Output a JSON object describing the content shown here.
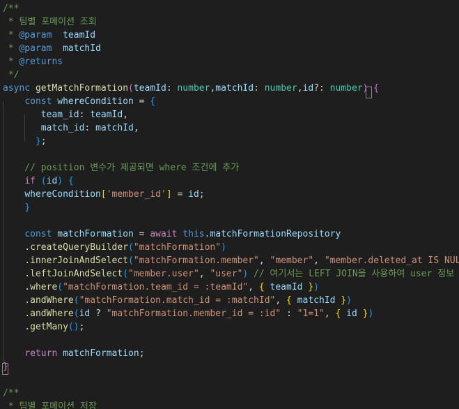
{
  "colors": {
    "background": "#1e1e1e",
    "comment": "#6a9955",
    "keyword": "#569cd6",
    "control": "#c586c0",
    "function": "#dcdcaa",
    "variable": "#9cdcfe",
    "type": "#4ec9b0",
    "string": "#ce9178",
    "text": "#d4d4d4",
    "bracket1": "#ffd700",
    "bracket2": "#da70d6",
    "bracket3": "#179fff",
    "docTag": "#569cd6"
  },
  "code_lines": [
    [
      {
        "t": "/**",
        "c": "comment"
      }
    ],
    [
      {
        "t": " * 팀별 포메이션 조회",
        "c": "comment"
      }
    ],
    [
      {
        "t": " * ",
        "c": "comment"
      },
      {
        "t": "@param",
        "c": "docTag"
      },
      {
        "t": "  ",
        "c": "comment"
      },
      {
        "t": "teamId",
        "c": "variable"
      }
    ],
    [
      {
        "t": " * ",
        "c": "comment"
      },
      {
        "t": "@param",
        "c": "docTag"
      },
      {
        "t": "  ",
        "c": "comment"
      },
      {
        "t": "matchId",
        "c": "variable"
      }
    ],
    [
      {
        "t": " * ",
        "c": "comment"
      },
      {
        "t": "@returns",
        "c": "docTag"
      }
    ],
    [
      {
        "t": " */",
        "c": "comment"
      }
    ],
    [
      {
        "t": "async ",
        "c": "keyword"
      },
      {
        "t": "getMatchFormation",
        "c": "function"
      },
      {
        "t": "(",
        "c": "bracket2"
      },
      {
        "t": "teamId",
        "c": "variable"
      },
      {
        "t": ": ",
        "c": "text"
      },
      {
        "t": "number",
        "c": "type"
      },
      {
        "t": ",",
        "c": "text"
      },
      {
        "t": "matchId",
        "c": "variable"
      },
      {
        "t": ": ",
        "c": "text"
      },
      {
        "t": "number",
        "c": "type"
      },
      {
        "t": ",",
        "c": "text"
      },
      {
        "t": "id",
        "c": "variable"
      },
      {
        "t": "?: ",
        "c": "text"
      },
      {
        "t": "number",
        "c": "type"
      },
      {
        "t": ")",
        "c": "bracket2"
      },
      {
        "t": " ",
        "c": "text"
      },
      {
        "t": "{",
        "c": "bracket2"
      }
    ],
    [
      {
        "t": "    ",
        "c": "text"
      },
      {
        "t": "const ",
        "c": "keyword"
      },
      {
        "t": "whereCondition",
        "c": "variable"
      },
      {
        "t": " = ",
        "c": "text"
      },
      {
        "t": "{",
        "c": "bracket3"
      }
    ],
    [
      {
        "t": "       ",
        "c": "text"
      },
      {
        "t": "team_id",
        "c": "variable"
      },
      {
        "t": ": ",
        "c": "text"
      },
      {
        "t": "teamId",
        "c": "variable"
      },
      {
        "t": ",",
        "c": "text"
      }
    ],
    [
      {
        "t": "       ",
        "c": "text"
      },
      {
        "t": "match_id",
        "c": "variable"
      },
      {
        "t": ": ",
        "c": "text"
      },
      {
        "t": "matchId",
        "c": "variable"
      },
      {
        "t": ",",
        "c": "text"
      }
    ],
    [
      {
        "t": "      ",
        "c": "text"
      },
      {
        "t": "}",
        "c": "bracket3"
      },
      {
        "t": ";",
        "c": "text"
      }
    ],
    [],
    [
      {
        "t": "    // position 변수가 제공되면 where 조건에 추가",
        "c": "comment"
      }
    ],
    [
      {
        "t": "    ",
        "c": "text"
      },
      {
        "t": "if ",
        "c": "control"
      },
      {
        "t": "(",
        "c": "bracket3"
      },
      {
        "t": "id",
        "c": "variable"
      },
      {
        "t": ")",
        "c": "bracket3"
      },
      {
        "t": " ",
        "c": "text"
      },
      {
        "t": "{",
        "c": "bracket3"
      }
    ],
    [
      {
        "t": "    ",
        "c": "text"
      },
      {
        "t": "whereCondition",
        "c": "variable"
      },
      {
        "t": "[",
        "c": "bracket1"
      },
      {
        "t": "'member_id'",
        "c": "string"
      },
      {
        "t": "]",
        "c": "bracket1"
      },
      {
        "t": " = ",
        "c": "text"
      },
      {
        "t": "id",
        "c": "variable"
      },
      {
        "t": ";",
        "c": "text"
      }
    ],
    [
      {
        "t": "    ",
        "c": "text"
      },
      {
        "t": "}",
        "c": "bracket3"
      }
    ],
    [],
    [
      {
        "t": "    ",
        "c": "text"
      },
      {
        "t": "const ",
        "c": "keyword"
      },
      {
        "t": "matchFormation",
        "c": "variable"
      },
      {
        "t": " = ",
        "c": "text"
      },
      {
        "t": "await ",
        "c": "control"
      },
      {
        "t": "this",
        "c": "keyword"
      },
      {
        "t": ".",
        "c": "text"
      },
      {
        "t": "matchFormationRepository",
        "c": "variable"
      }
    ],
    [
      {
        "t": "    .",
        "c": "text"
      },
      {
        "t": "createQueryBuilder",
        "c": "function"
      },
      {
        "t": "(",
        "c": "bracket3"
      },
      {
        "t": "\"matchFormation\"",
        "c": "string"
      },
      {
        "t": ")",
        "c": "bracket3"
      }
    ],
    [
      {
        "t": "    .",
        "c": "text"
      },
      {
        "t": "innerJoinAndSelect",
        "c": "function"
      },
      {
        "t": "(",
        "c": "bracket3"
      },
      {
        "t": "\"matchFormation.member\"",
        "c": "string"
      },
      {
        "t": ", ",
        "c": "text"
      },
      {
        "t": "\"member\"",
        "c": "string"
      },
      {
        "t": ", ",
        "c": "text"
      },
      {
        "t": "\"member.deleted_at IS NULL\"",
        "c": "string"
      }
    ],
    [
      {
        "t": "    .",
        "c": "text"
      },
      {
        "t": "leftJoinAndSelect",
        "c": "function"
      },
      {
        "t": "(",
        "c": "bracket3"
      },
      {
        "t": "\"member.user\"",
        "c": "string"
      },
      {
        "t": ", ",
        "c": "text"
      },
      {
        "t": "\"user\"",
        "c": "string"
      },
      {
        "t": ")",
        "c": "bracket3"
      },
      {
        "t": " // 여기서는 LEFT JOIN을 사용하여 user 정보",
        "c": "comment"
      }
    ],
    [
      {
        "t": "    .",
        "c": "text"
      },
      {
        "t": "where",
        "c": "function"
      },
      {
        "t": "(",
        "c": "bracket3"
      },
      {
        "t": "\"matchFormation.team_id = :teamId\"",
        "c": "string"
      },
      {
        "t": ", ",
        "c": "text"
      },
      {
        "t": "{",
        "c": "bracket1"
      },
      {
        "t": " ",
        "c": "text"
      },
      {
        "t": "teamId",
        "c": "variable"
      },
      {
        "t": " ",
        "c": "text"
      },
      {
        "t": "}",
        "c": "bracket1"
      },
      {
        "t": ")",
        "c": "bracket3"
      }
    ],
    [
      {
        "t": "    .",
        "c": "text"
      },
      {
        "t": "andWhere",
        "c": "function"
      },
      {
        "t": "(",
        "c": "bracket3"
      },
      {
        "t": "\"matchFormation.match_id = :matchId\"",
        "c": "string"
      },
      {
        "t": ", ",
        "c": "text"
      },
      {
        "t": "{",
        "c": "bracket1"
      },
      {
        "t": " ",
        "c": "text"
      },
      {
        "t": "matchId",
        "c": "variable"
      },
      {
        "t": " ",
        "c": "text"
      },
      {
        "t": "}",
        "c": "bracket1"
      },
      {
        "t": ")",
        "c": "bracket3"
      }
    ],
    [
      {
        "t": "    .",
        "c": "text"
      },
      {
        "t": "andWhere",
        "c": "function"
      },
      {
        "t": "(",
        "c": "bracket3"
      },
      {
        "t": "id",
        "c": "variable"
      },
      {
        "t": " ? ",
        "c": "text"
      },
      {
        "t": "\"matchFormation.member_id = :id\"",
        "c": "string"
      },
      {
        "t": " : ",
        "c": "text"
      },
      {
        "t": "\"1=1\"",
        "c": "string"
      },
      {
        "t": ", ",
        "c": "text"
      },
      {
        "t": "{",
        "c": "bracket1"
      },
      {
        "t": " ",
        "c": "text"
      },
      {
        "t": "id",
        "c": "variable"
      },
      {
        "t": " ",
        "c": "text"
      },
      {
        "t": "}",
        "c": "bracket1"
      },
      {
        "t": ")",
        "c": "bracket3"
      }
    ],
    [
      {
        "t": "    .",
        "c": "text"
      },
      {
        "t": "getMany",
        "c": "function"
      },
      {
        "t": "(",
        "c": "bracket3"
      },
      {
        "t": ")",
        "c": "bracket3"
      },
      {
        "t": ";",
        "c": "text"
      }
    ],
    [],
    [
      {
        "t": "    ",
        "c": "text"
      },
      {
        "t": "return ",
        "c": "control"
      },
      {
        "t": "matchFormation",
        "c": "variable"
      },
      {
        "t": ";",
        "c": "text"
      }
    ],
    [
      {
        "t": "}",
        "c": "bracket2"
      }
    ],
    [],
    [
      {
        "t": "/**",
        "c": "comment"
      }
    ],
    [
      {
        "t": " * 팀별 포메이션 저장",
        "c": "comment"
      }
    ]
  ]
}
